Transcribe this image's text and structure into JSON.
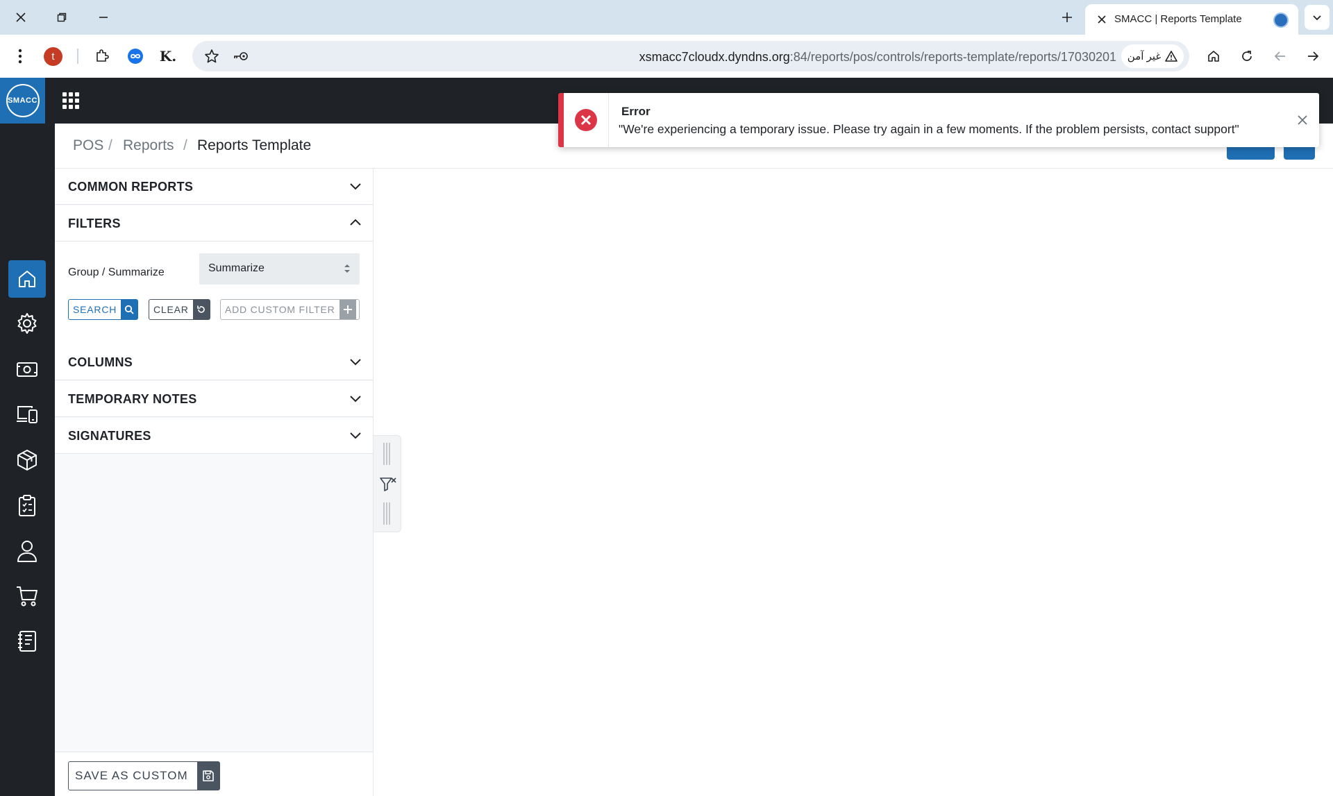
{
  "browser": {
    "tab_title": "SMACC | Reports Template",
    "url_main": "xsmacc7cloudx.dyndns.org",
    "url_rest": ":84/reports/pos/controls/reports-template/reports/17030201",
    "security_label": "غير آمن",
    "profile_initial": "t",
    "extension_letter": "K."
  },
  "app": {
    "logo_text": "SMACC",
    "accent_color": "#1f6fb5"
  },
  "breadcrumb": {
    "items": [
      "POS",
      "Reports",
      "Reports Template"
    ],
    "separator": "/"
  },
  "sidebar": {
    "items": [
      {
        "icon": "home-icon",
        "active": true
      },
      {
        "icon": "gear-icon",
        "active": false
      },
      {
        "icon": "cash-icon",
        "active": false
      },
      {
        "icon": "devices-icon",
        "active": false
      },
      {
        "icon": "box-icon",
        "active": false
      },
      {
        "icon": "clipboard-icon",
        "active": false
      },
      {
        "icon": "user-icon",
        "active": false
      },
      {
        "icon": "cart-icon",
        "active": false
      },
      {
        "icon": "ledger-icon",
        "active": false
      }
    ]
  },
  "panel": {
    "common_reports": "COMMON REPORTS",
    "filters": "FILTERS",
    "group_label": "Group / Summarize",
    "group_value": "Summarize",
    "search_label": "SEARCH",
    "clear_label": "CLEAR",
    "add_filter_label": "ADD CUSTOM FILTER",
    "columns": "COLUMNS",
    "temporary_notes": "TEMPORARY NOTES",
    "signatures": "SIGNATURES",
    "save_label": "SAVE AS CUSTOM"
  },
  "toast": {
    "title": "Error",
    "message": "\"We're experiencing a temporary issue. Please try again in a few moments. If the problem persists, contact support\"",
    "color": "#dc3545"
  }
}
